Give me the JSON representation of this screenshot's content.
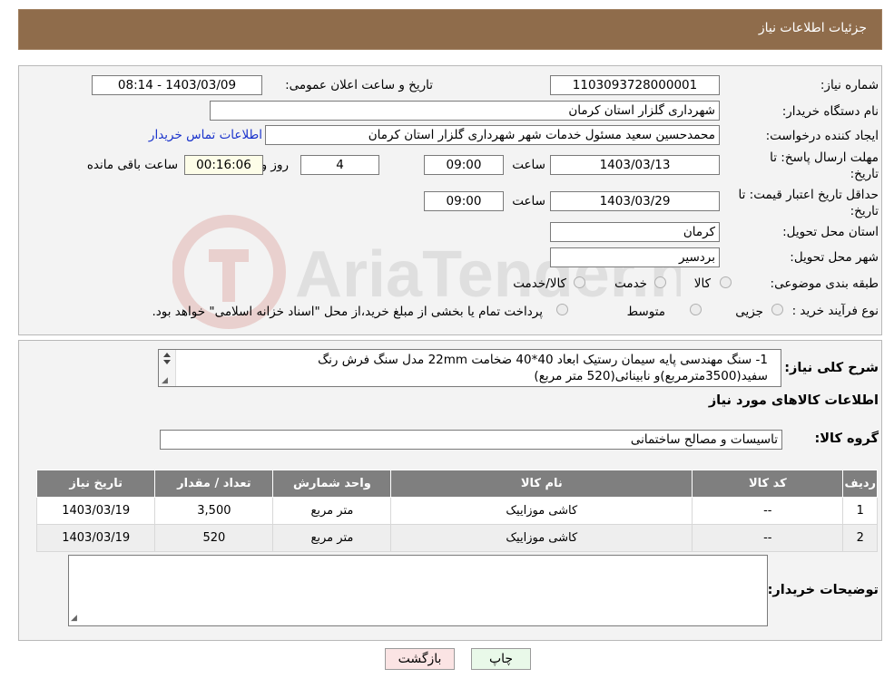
{
  "header": {
    "title": "جزئیات اطلاعات نیاز"
  },
  "need": {
    "number_label": "شماره نیاز:",
    "number_value": "1103093728000001",
    "announce_label": "تاریخ و ساعت اعلان عمومی:",
    "announce_value": "1403/03/09 - 08:14",
    "buyer_label": "نام دستگاه خریدار:",
    "buyer_value": "شهرداری گلزار استان کرمان",
    "creator_label": "ایجاد کننده درخواست:",
    "creator_value": "محمدحسین سعید مسئول خدمات شهر شهرداری گلزار استان کرمان",
    "contact_link": "اطلاعات تماس خریدار",
    "deadline_label_1": "مهلت ارسال پاسخ: تا",
    "deadline_label_2": "تاریخ:",
    "deadline_date": "1403/03/13",
    "time_label": "ساعت",
    "deadline_time": "09:00",
    "days_value": "4",
    "days_label": "روز و",
    "remaining_value": "00:16:06",
    "remaining_label": "ساعت باقی مانده",
    "validity_label_1": "حداقل تاریخ اعتبار قیمت: تا",
    "validity_label_2": "تاریخ:",
    "validity_date": "1403/03/29",
    "validity_time": "09:00",
    "province_label": "استان محل تحویل:",
    "province_value": "کرمان",
    "city_label": "شهر محل تحویل:",
    "city_value": "بردسیر",
    "category_label": "طبقه بندی موضوعی:",
    "category_options": [
      "کالا",
      "خدمت",
      "کالا/خدمت"
    ],
    "process_label": "نوع فرآیند خرید :",
    "process_options": [
      "جزیی",
      "متوسط"
    ],
    "process_note": "پرداخت تمام یا بخشی از مبلغ خرید،از محل \"اسناد خزانه اسلامی\" خواهد بود."
  },
  "description": {
    "label": "شرح کلی نیاز:",
    "line1": "1- سنگ مهندسی پایه سیمان رستیک ابعاد 40*40 ضخامت 22mm مدل سنگ فرش رنگ",
    "line2": "سفید(3500مترمربع)و نابینائی(520 متر مربع)"
  },
  "goods": {
    "section_title": "اطلاعات کالاهای مورد نیاز",
    "group_label": "گروه کالا:",
    "group_value": "تاسیسات و مصالح ساختمانی",
    "columns": [
      "ردیف",
      "کد کالا",
      "نام کالا",
      "واحد شمارش",
      "تعداد / مقدار",
      "تاریخ نیاز"
    ],
    "rows": [
      [
        "1",
        "--",
        "کاشی موزاییک",
        "متر مربع",
        "3,500",
        "1403/03/19"
      ],
      [
        "2",
        "--",
        "کاشی موزاییک",
        "متر مربع",
        "520",
        "1403/03/19"
      ]
    ]
  },
  "buyer_notes": {
    "label": "توضیحات خریدار:",
    "value": ""
  },
  "buttons": {
    "print": "چاپ",
    "back": "بازگشت"
  },
  "watermark": {
    "text": "AriaTender.neT"
  }
}
